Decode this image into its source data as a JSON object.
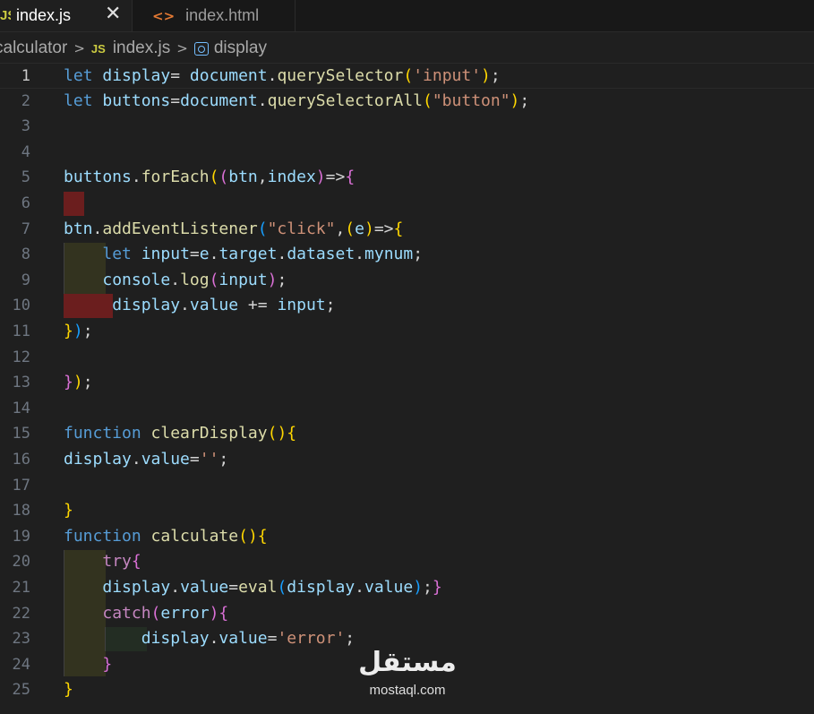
{
  "tabs": [
    {
      "label": "index.js",
      "icon": "js-file-icon",
      "active": true,
      "close_glyph": "✕"
    },
    {
      "label": "index.html",
      "icon": "html-file-icon",
      "active": false
    }
  ],
  "breadcrumb": {
    "folder": "calculator",
    "file": "index.js",
    "symbol": "display",
    "js_icon_text": "JS"
  },
  "code_lines": [
    "let display= document.querySelector('input');",
    "let buttons=document.querySelectorAll(\"button\");",
    "",
    "",
    "buttons.forEach((btn,index)=>{",
    "",
    "btn.addEventListener(\"click\",(e)=>{",
    "    let input=e.target.dataset.mynum;",
    "    console.log(input);",
    "     display.value += input;",
    "});",
    "",
    "});",
    "",
    "function clearDisplay(){",
    "display.value='';",
    "",
    "}",
    "function calculate(){",
    "    try{",
    "    display.value=eval(display.value);}",
    "    catch(error){",
    "        display.value='error';",
    "    }",
    "}"
  ],
  "line_numbers": [
    "1",
    "2",
    "3",
    "4",
    "5",
    "6",
    "7",
    "8",
    "9",
    "10",
    "11",
    "12",
    "13",
    "14",
    "15",
    "16",
    "17",
    "18",
    "19",
    "20",
    "21",
    "22",
    "23",
    "24",
    "25"
  ],
  "current_line": "1",
  "watermark": {
    "arabic": "مستقل",
    "latin": "mostaql.com"
  },
  "colors": {
    "background": "#1f1f1f",
    "keyword": "#569cd6",
    "variable": "#9cdcfe",
    "function": "#dcdcaa",
    "string": "#ce9178",
    "control": "#c586c0",
    "bracket_1": "#ffd700",
    "bracket_2": "#da70d6",
    "bracket_3": "#179fff",
    "indent_error": "#6b1e1e",
    "indent_guide": "#33331f"
  }
}
